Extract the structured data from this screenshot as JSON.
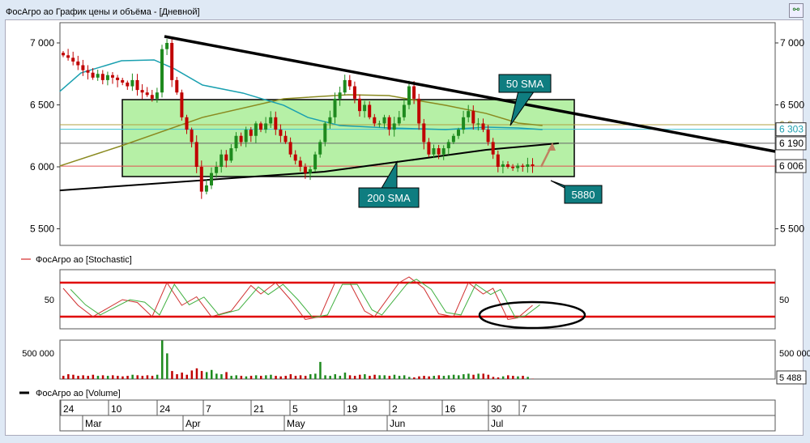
{
  "window": {
    "title": "ФосАгро ао График цены и объёма - [Дневной]",
    "corner_icon": "link-icon"
  },
  "price_axis": {
    "ticks": [
      7000,
      6500,
      6000,
      5500
    ],
    "tick_labels": [
      "7 000",
      "6 500",
      "6 000",
      "5 500"
    ],
    "ylim": [
      5300,
      7170
    ]
  },
  "price_tags": {
    "olive": "6 3..",
    "cyan": "6 303",
    "black": "6 190",
    "red": "6 006"
  },
  "annotations": {
    "sma50": "50 SMA",
    "sma200": "200 SMA",
    "level": "5880"
  },
  "stoch": {
    "legend": "ФосАгро ао [Stochastic]",
    "tick_label": "50",
    "levels": [
      80,
      20
    ]
  },
  "volume": {
    "legend": "ФосАгро ао [Volume]",
    "tick_label": "500 000",
    "last_label": "5 488"
  },
  "xaxis": {
    "days": [
      "24",
      "10",
      "24",
      "7",
      "21",
      "5",
      "19",
      "2",
      "16",
      "30",
      "7"
    ],
    "months": [
      "Mar",
      "Apr",
      "May",
      "Jun",
      "Jul"
    ]
  },
  "colors": {
    "up": "#1e8a1e",
    "down": "#c00000",
    "sma50": "#1aa0b0",
    "sma100": "#8a8a20",
    "sma200": "#000000",
    "box": "#b6f0a6"
  },
  "chart_data": {
    "type": "candlestick",
    "closes": [
      6900,
      6880,
      6850,
      6820,
      6780,
      6760,
      6720,
      6750,
      6700,
      6740,
      6720,
      6700,
      6680,
      6650,
      6700,
      6620,
      6600,
      6580,
      6550,
      6600,
      6950,
      7000,
      6700,
      6600,
      6400,
      6300,
      6200,
      6000,
      5800,
      5850,
      5950,
      6000,
      6100,
      6050,
      6150,
      6250,
      6200,
      6300,
      6250,
      6350,
      6300,
      6350,
      6400,
      6300,
      6250,
      6200,
      6100,
      6050,
      6000,
      5950,
      5980,
      6100,
      6200,
      6350,
      6400,
      6550,
      6600,
      6700,
      6650,
      6550,
      6450,
      6500,
      6400,
      6350,
      6350,
      6400,
      6300,
      6350,
      6400,
      6500,
      6650,
      6550,
      6350,
      6200,
      6100,
      6150,
      6100,
      6150,
      6200,
      6250,
      6300,
      6400,
      6450,
      6350,
      6350,
      6300,
      6200,
      6100,
      6000,
      6020,
      6000,
      5990,
      6010,
      6000,
      6020,
      6006
    ],
    "volumes": [
      60000,
      90000,
      80000,
      60000,
      70000,
      60000,
      80000,
      60000,
      70000,
      60000,
      70000,
      60000,
      50000,
      60000,
      80000,
      70000,
      60000,
      70000,
      60000,
      80000,
      720000,
      480000,
      150000,
      90000,
      120000,
      80000,
      160000,
      200000,
      150000,
      130000,
      170000,
      100000,
      90000,
      130000,
      60000,
      70000,
      60000,
      50000,
      60000,
      70000,
      60000,
      70000,
      80000,
      60000,
      50000,
      60000,
      90000,
      60000,
      70000,
      60000,
      90000,
      100000,
      320000,
      70000,
      60000,
      90000,
      60000,
      120000,
      70000,
      60000,
      80000,
      90000,
      60000,
      80000,
      70000,
      70000,
      60000,
      80000,
      60000,
      70000,
      40000,
      30000,
      50000,
      60000,
      50000,
      60000,
      70000,
      60000,
      70000,
      80000,
      70000,
      90000,
      100000,
      80000,
      100000,
      100000,
      80000,
      40000,
      30000,
      50000,
      70000,
      60000,
      50000,
      60000,
      40000,
      5488
    ],
    "sma50": [
      [
        -0.7,
        6608
      ],
      [
        3.6,
        6758
      ],
      [
        11.8,
        6856
      ],
      [
        18.4,
        6863
      ],
      [
        22.5,
        6791
      ],
      [
        28.2,
        6660
      ],
      [
        36.4,
        6595
      ],
      [
        44.6,
        6497
      ],
      [
        49.5,
        6399
      ],
      [
        56,
        6333
      ],
      [
        65.9,
        6314
      ],
      [
        77.4,
        6301
      ],
      [
        85.6,
        6320
      ],
      [
        92.1,
        6314
      ],
      [
        97,
        6301
      ]
    ],
    "sma100": [
      [
        -0.7,
        6007
      ],
      [
        11.8,
        6170
      ],
      [
        28.2,
        6399
      ],
      [
        44.6,
        6549
      ],
      [
        57.7,
        6582
      ],
      [
        65.9,
        6575
      ],
      [
        77.4,
        6497
      ],
      [
        85.6,
        6431
      ],
      [
        92.1,
        6353
      ],
      [
        97,
        6333
      ]
    ],
    "sma200": [
      [
        -0.7,
        5810
      ],
      [
        52.8,
        5961
      ],
      [
        67.5,
        6039
      ],
      [
        85.6,
        6137
      ],
      [
        100.3,
        6190
      ]
    ],
    "stoch_k": [
      [
        0,
        70
      ],
      [
        3,
        40
      ],
      [
        6,
        20
      ],
      [
        12,
        50
      ],
      [
        15,
        45
      ],
      [
        18,
        20
      ],
      [
        21,
        80
      ],
      [
        24,
        40
      ],
      [
        27,
        55
      ],
      [
        30,
        20
      ],
      [
        34,
        30
      ],
      [
        38,
        75
      ],
      [
        40,
        60
      ],
      [
        43,
        80
      ],
      [
        46,
        50
      ],
      [
        49,
        15
      ],
      [
        52,
        20
      ],
      [
        55,
        80
      ],
      [
        58,
        80
      ],
      [
        61,
        30
      ],
      [
        63,
        20
      ],
      [
        68,
        80
      ],
      [
        70,
        90
      ],
      [
        73,
        70
      ],
      [
        76,
        25
      ],
      [
        79,
        20
      ],
      [
        82,
        80
      ],
      [
        85,
        60
      ],
      [
        87,
        70
      ],
      [
        90,
        15
      ],
      [
        92,
        18
      ],
      [
        95,
        40
      ]
    ],
    "hlines": {
      "sma100_last": 6340,
      "sma50_last": 6303,
      "sma200_last": 6190,
      "last_close": 6006
    }
  }
}
